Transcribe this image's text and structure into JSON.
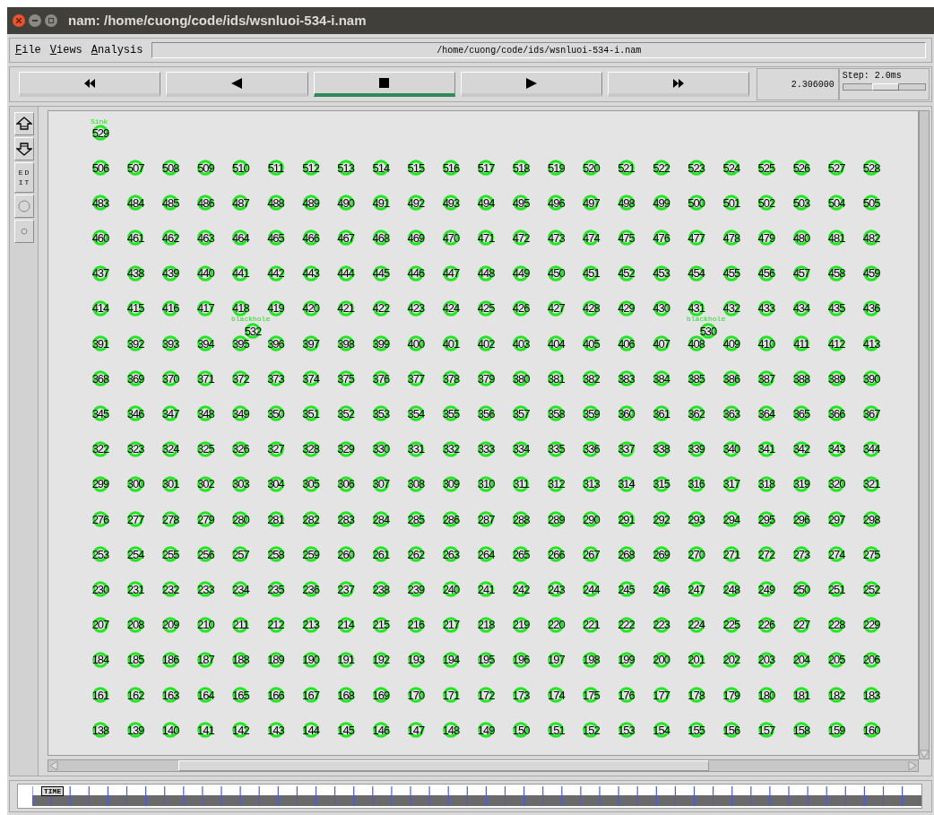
{
  "window": {
    "title": "nam: /home/cuong/code/ids/wsnluoi-534-i.nam"
  },
  "menu": [
    {
      "label": "File"
    },
    {
      "label": "Views"
    },
    {
      "label": "Analysis"
    }
  ],
  "path_field": {
    "value": "/home/cuong/code/ids/wsnluoi-534-i.nam"
  },
  "playback_buttons": [
    {
      "kind": "rewind",
      "selected": false
    },
    {
      "kind": "back",
      "selected": false
    },
    {
      "kind": "stop",
      "selected": true
    },
    {
      "kind": "play",
      "selected": false
    },
    {
      "kind": "fast_forward",
      "selected": false
    }
  ],
  "time": "2.306000",
  "step": {
    "label": "Step: 2.0ms",
    "level": 0.52
  },
  "left_tools": [
    {
      "kind": "zoom_in"
    },
    {
      "kind": "zoom_out"
    },
    {
      "kind": "edit",
      "label": "EDIT"
    },
    {
      "kind": "large_circle"
    },
    {
      "kind": "small_circle"
    }
  ],
  "grid_rows": [
    {
      "nodes": [
        "506",
        "507",
        "508",
        "509",
        "510",
        "511",
        "512",
        "513",
        "514",
        "515",
        "516",
        "517",
        "518",
        "519",
        "520",
        "521",
        "522",
        "523",
        "524",
        "525",
        "526",
        "527",
        "528"
      ]
    },
    {
      "nodes": [
        "483",
        "484",
        "485",
        "486",
        "487",
        "488",
        "489",
        "490",
        "491",
        "492",
        "493",
        "494",
        "495",
        "496",
        "497",
        "498",
        "499",
        "500",
        "501",
        "502",
        "503",
        "504",
        "505"
      ]
    },
    {
      "nodes": [
        "460",
        "461",
        "462",
        "463",
        "464",
        "465",
        "466",
        "467",
        "468",
        "469",
        "470",
        "471",
        "472",
        "473",
        "474",
        "475",
        "476",
        "477",
        "478",
        "479",
        "480",
        "481",
        "482"
      ]
    },
    {
      "nodes": [
        "437",
        "438",
        "439",
        "440",
        "441",
        "442",
        "443",
        "444",
        "445",
        "446",
        "447",
        "448",
        "449",
        "450",
        "451",
        "452",
        "453",
        "454",
        "455",
        "456",
        "457",
        "458",
        "459"
      ]
    },
    {
      "nodes": [
        "414",
        "415",
        "416",
        "417",
        "418",
        "419",
        "420",
        "421",
        "422",
        "423",
        "424",
        "425",
        "426",
        "427",
        "428",
        "429",
        "430",
        "431",
        "432",
        "433",
        "434",
        "435",
        "436"
      ]
    },
    {
      "nodes": [
        "391",
        "392",
        "393",
        "394",
        "395",
        "396",
        "397",
        "398",
        "399",
        "400",
        "401",
        "402",
        "403",
        "404",
        "405",
        "406",
        "407",
        "408",
        "409",
        "410",
        "411",
        "412",
        "413"
      ]
    },
    {
      "nodes": [
        "368",
        "369",
        "370",
        "371",
        "372",
        "373",
        "374",
        "375",
        "376",
        "377",
        "378",
        "379",
        "380",
        "381",
        "382",
        "383",
        "384",
        "385",
        "386",
        "387",
        "388",
        "389",
        "390"
      ]
    },
    {
      "nodes": [
        "345",
        "346",
        "347",
        "348",
        "349",
        "350",
        "351",
        "352",
        "353",
        "354",
        "355",
        "356",
        "357",
        "358",
        "359",
        "360",
        "361",
        "362",
        "363",
        "364",
        "365",
        "366",
        "367"
      ]
    },
    {
      "nodes": [
        "322",
        "323",
        "324",
        "325",
        "326",
        "327",
        "328",
        "329",
        "330",
        "331",
        "332",
        "333",
        "334",
        "335",
        "336",
        "337",
        "338",
        "339",
        "340",
        "341",
        "342",
        "343",
        "344"
      ]
    },
    {
      "nodes": [
        "299",
        "300",
        "301",
        "302",
        "303",
        "304",
        "305",
        "306",
        "307",
        "308",
        "309",
        "310",
        "311",
        "312",
        "313",
        "314",
        "315",
        "316",
        "317",
        "318",
        "319",
        "320",
        "321"
      ]
    },
    {
      "nodes": [
        "276",
        "277",
        "278",
        "279",
        "280",
        "281",
        "282",
        "283",
        "284",
        "285",
        "286",
        "287",
        "288",
        "289",
        "290",
        "291",
        "292",
        "293",
        "294",
        "295",
        "296",
        "297",
        "298"
      ]
    },
    {
      "nodes": [
        "253",
        "254",
        "255",
        "256",
        "257",
        "258",
        "259",
        "260",
        "261",
        "262",
        "263",
        "264",
        "265",
        "266",
        "267",
        "268",
        "269",
        "270",
        "271",
        "272",
        "273",
        "274",
        "275"
      ]
    },
    {
      "nodes": [
        "230",
        "231",
        "232",
        "233",
        "234",
        "235",
        "236",
        "237",
        "238",
        "239",
        "240",
        "241",
        "242",
        "243",
        "244",
        "245",
        "246",
        "247",
        "248",
        "249",
        "250",
        "251",
        "252"
      ]
    },
    {
      "nodes": [
        "207",
        "208",
        "209",
        "210",
        "211",
        "212",
        "213",
        "214",
        "215",
        "216",
        "217",
        "218",
        "219",
        "220",
        "221",
        "222",
        "223",
        "224",
        "225",
        "226",
        "227",
        "228",
        "229"
      ]
    },
    {
      "nodes": [
        "184",
        "185",
        "186",
        "187",
        "188",
        "189",
        "190",
        "191",
        "192",
        "193",
        "194",
        "195",
        "196",
        "197",
        "198",
        "199",
        "200",
        "201",
        "202",
        "203",
        "204",
        "205",
        "206"
      ]
    },
    {
      "nodes": [
        "161",
        "162",
        "163",
        "164",
        "165",
        "166",
        "167",
        "168",
        "169",
        "170",
        "171",
        "172",
        "173",
        "174",
        "175",
        "176",
        "177",
        "178",
        "179",
        "180",
        "181",
        "182",
        "183"
      ]
    },
    {
      "nodes": [
        "138",
        "139",
        "140",
        "141",
        "142",
        "143",
        "144",
        "145",
        "146",
        "147",
        "148",
        "149",
        "150",
        "151",
        "152",
        "153",
        "154",
        "155",
        "156",
        "157",
        "158",
        "159",
        "160"
      ]
    }
  ],
  "special_nodes": [
    {
      "kind": "sink",
      "caption": "Sink",
      "label": "529"
    },
    {
      "kind": "blackhole",
      "caption": "blackhole",
      "label": "532"
    },
    {
      "kind": "blackhole",
      "caption": "blackhole",
      "label": "530"
    }
  ],
  "timeline": {
    "marker": "TIME"
  }
}
